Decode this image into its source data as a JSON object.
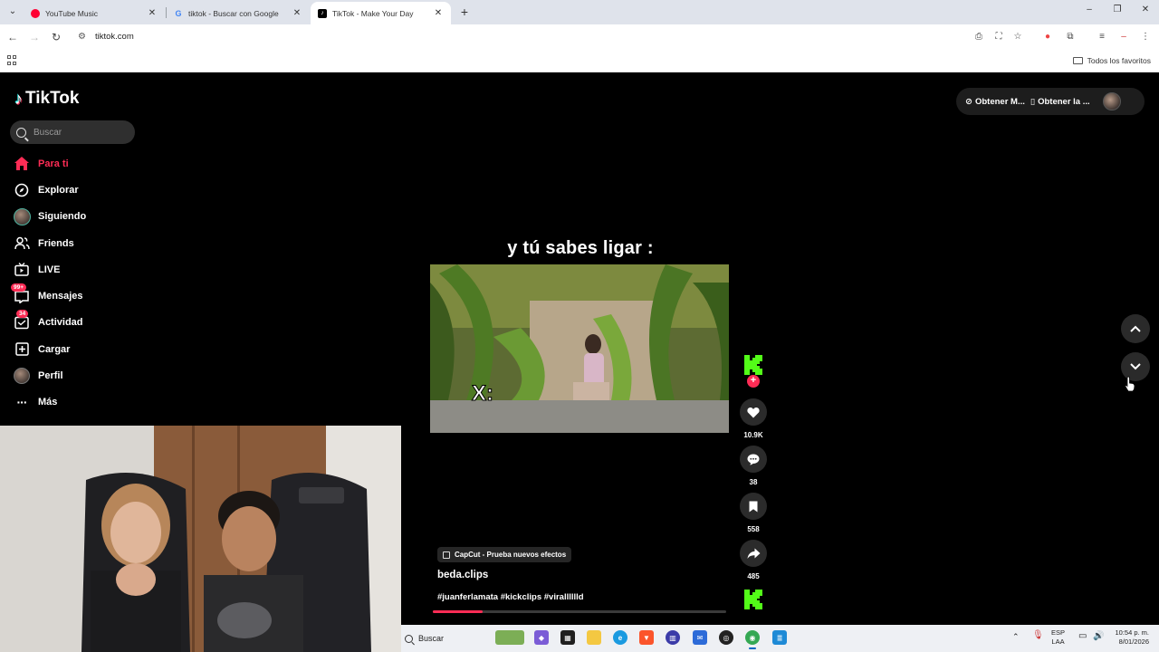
{
  "browser": {
    "tabs": [
      {
        "title": "YouTube Music",
        "active": false,
        "icon": "youtube-music-icon",
        "color": "#ff0033"
      },
      {
        "title": "tiktok - Buscar con Google",
        "active": false,
        "icon": "google-icon",
        "color": "#4285f4"
      },
      {
        "title": "TikTok - Make Your Day",
        "active": true,
        "icon": "tiktok-icon",
        "color": "#000000"
      }
    ],
    "url": "tiktok.com",
    "bookmarks_all": "Todos los favoritos"
  },
  "tiktok": {
    "logo_text": "TikTok",
    "search_placeholder": "Buscar",
    "nav": [
      {
        "label": "Para ti",
        "icon": "home-icon",
        "active": true
      },
      {
        "label": "Explorar",
        "icon": "compass-icon",
        "active": false
      },
      {
        "label": "Siguiendo",
        "icon": "following-avatar-icon",
        "active": false
      },
      {
        "label": "Friends",
        "icon": "friends-icon",
        "active": false
      },
      {
        "label": "LIVE",
        "icon": "live-tv-icon",
        "active": false
      },
      {
        "label": "Mensajes",
        "icon": "messages-icon",
        "active": false,
        "badge": "99+"
      },
      {
        "label": "Actividad",
        "icon": "activity-icon",
        "active": false,
        "badge": "34"
      },
      {
        "label": "Cargar",
        "icon": "upload-icon",
        "active": false
      },
      {
        "label": "Perfil",
        "icon": "profile-avatar-icon",
        "active": false
      },
      {
        "label": "Más",
        "icon": "more-icon",
        "active": false
      }
    ],
    "top_right": {
      "get_app": "Obtener M...",
      "get_app2": "Obtener la ..."
    },
    "video": {
      "caption": "y tú sabes ligar :",
      "overlay_text": "X:",
      "effect": "CapCut - Prueba nuevos efectos",
      "author": "beda.clips",
      "hashtags": "#juanferlamata #kickclips #viralllllld",
      "progress": 0.17
    },
    "actions": {
      "likes": "10.9K",
      "comments": "38",
      "saves": "558",
      "shares": "485"
    },
    "brand_color": "#fe2c55",
    "kick_color": "#53fc18"
  },
  "taskbar": {
    "search_label": "Buscar",
    "lang_top": "ESP",
    "lang_bottom": "LAA",
    "time": "10:54 p. m.",
    "date": "8/01/2026"
  }
}
